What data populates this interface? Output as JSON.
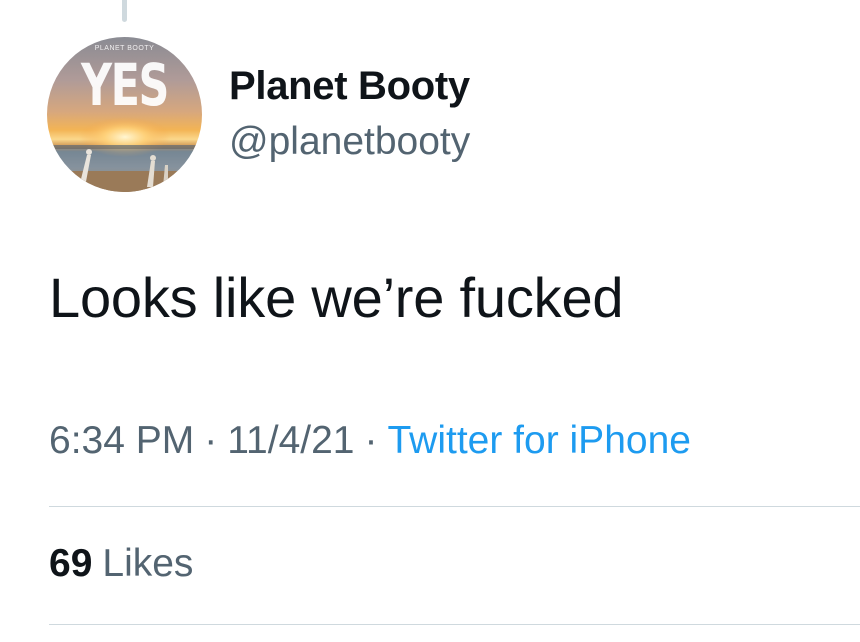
{
  "tweet": {
    "author": {
      "display_name": "Planet Booty",
      "handle": "@planetbooty",
      "avatar": {
        "word": "YES",
        "caption": "PLANET BOOTY"
      }
    },
    "text": "Looks like we’re fucked",
    "meta": {
      "time": "6:34 PM",
      "date": "11/4/21",
      "separator": "·",
      "source": "Twitter for iPhone"
    },
    "stats": {
      "likes_count": "69",
      "likes_label": "Likes"
    }
  },
  "colors": {
    "text_primary": "#0f1419",
    "text_secondary": "#536471",
    "link": "#1d9bf0",
    "divider": "#cfd9de"
  }
}
